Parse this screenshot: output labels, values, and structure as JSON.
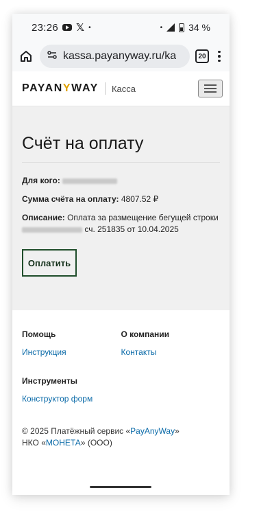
{
  "status_bar": {
    "time": "23:26",
    "notification_icons": [
      "youtube-icon",
      "x-icon"
    ],
    "dot": "•",
    "battery_percent": "34 %"
  },
  "browser": {
    "url": "kassa.payanyway.ru/ka",
    "tab_count": "20"
  },
  "header": {
    "logo_part1": "PAYAN",
    "logo_y": "Y",
    "logo_part2": "WAY",
    "section": "Касса"
  },
  "invoice": {
    "title": "Счёт на оплату",
    "for_label": "Для кого:",
    "amount_label": "Сумма счёта на оплату:",
    "amount_value": "4807.52 ₽",
    "description_label": "Описание:",
    "description_line1": "Оплата за размещение бегущей строки",
    "description_line2": "сч. 251835 от 10.04.2025",
    "pay_button": "Оплатить"
  },
  "footer": {
    "help_title": "Помощь",
    "help_link": "Инструкция",
    "company_title": "О компании",
    "company_link": "Контакты",
    "tools_title": "Инструменты",
    "tools_link": "Конструктор форм",
    "copyright_prefix": "© 2025 Платёжный сервис «",
    "copyright_brand": "PayAnyWay",
    "copyright_suffix": "»",
    "nko_prefix": "НКО «",
    "nko_brand": "МОНЕТА",
    "nko_suffix": "» (ООО)"
  },
  "colors": {
    "accent_link": "#0a6aa8",
    "button_border": "#1f4d2a",
    "logo_accent": "#e0a200"
  }
}
